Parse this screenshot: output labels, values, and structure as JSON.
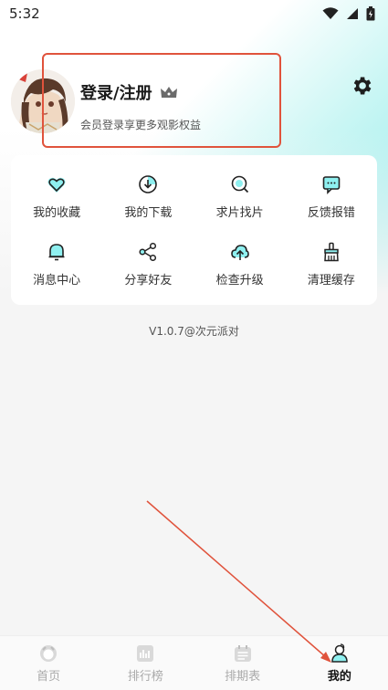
{
  "status_bar": {
    "time": "5:32"
  },
  "profile": {
    "login_label": "登录/注册",
    "vip_subtitle": "会员登录享更多观影权益"
  },
  "menu": {
    "items": [
      {
        "label": "我的收藏",
        "icon": "heart-icon"
      },
      {
        "label": "我的下载",
        "icon": "download-icon"
      },
      {
        "label": "求片找片",
        "icon": "search-film-icon"
      },
      {
        "label": "反馈报错",
        "icon": "feedback-icon"
      },
      {
        "label": "消息中心",
        "icon": "bell-icon"
      },
      {
        "label": "分享好友",
        "icon": "share-icon"
      },
      {
        "label": "检查升级",
        "icon": "upgrade-icon"
      },
      {
        "label": "清理缓存",
        "icon": "broom-icon"
      }
    ]
  },
  "version": "V1.0.7@次元派对",
  "bottom_nav": {
    "items": [
      {
        "label": "首页",
        "icon": "home-icon"
      },
      {
        "label": "排行榜",
        "icon": "ranking-icon"
      },
      {
        "label": "排期表",
        "icon": "calendar-icon"
      },
      {
        "label": "我的",
        "icon": "profile-icon",
        "active": true
      }
    ]
  },
  "colors": {
    "accent": "#7ee8e8",
    "highlight": "#e0533c",
    "icon_fill": "#8ff0f0"
  }
}
